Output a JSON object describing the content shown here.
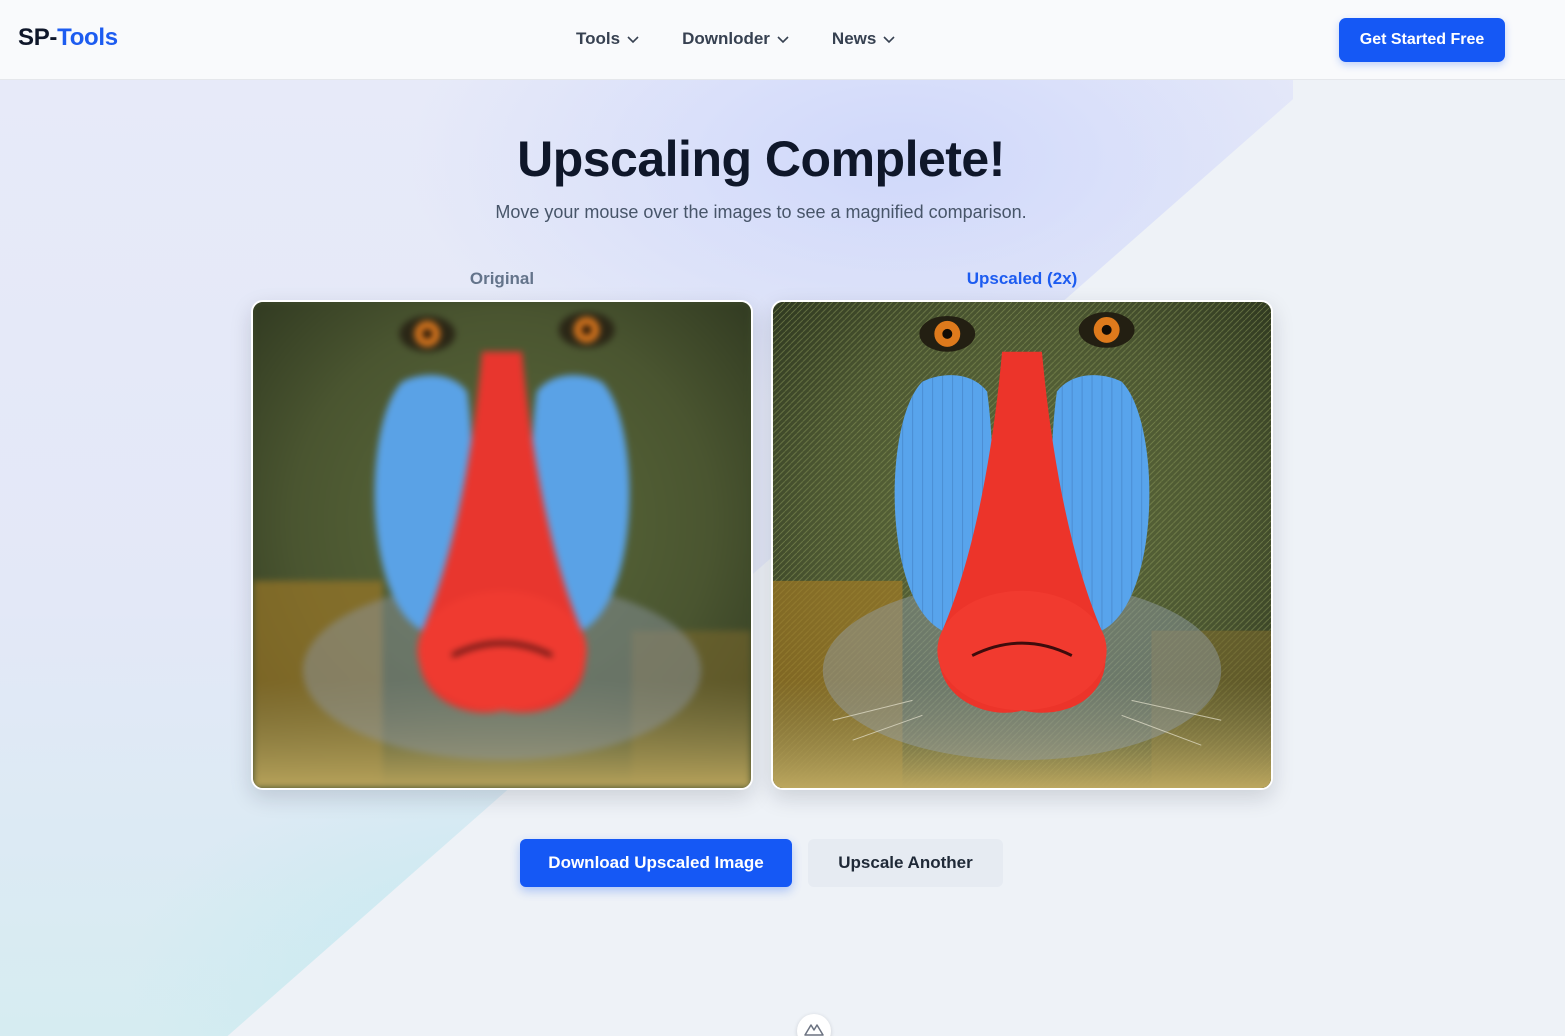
{
  "header": {
    "logo_part1": "SP-",
    "logo_part2": "Tools",
    "nav": [
      {
        "label": "Tools"
      },
      {
        "label": "Downloder"
      },
      {
        "label": "News"
      }
    ],
    "cta_label": "Get Started Free"
  },
  "main": {
    "title": "Upscaling Complete!",
    "subtitle": "Move your mouse over the images to see a magnified comparison.",
    "original_label": "Original",
    "upscaled_label": "Upscaled (2x)",
    "download_label": "Download Upscaled Image",
    "another_label": "Upscale Another"
  },
  "colors": {
    "accent": "#1558f5",
    "heading": "#0f172a",
    "muted": "#64748b"
  },
  "icons": {
    "nav_chevron": "chevron-down-icon",
    "badge": "mountain-logo-icon"
  }
}
